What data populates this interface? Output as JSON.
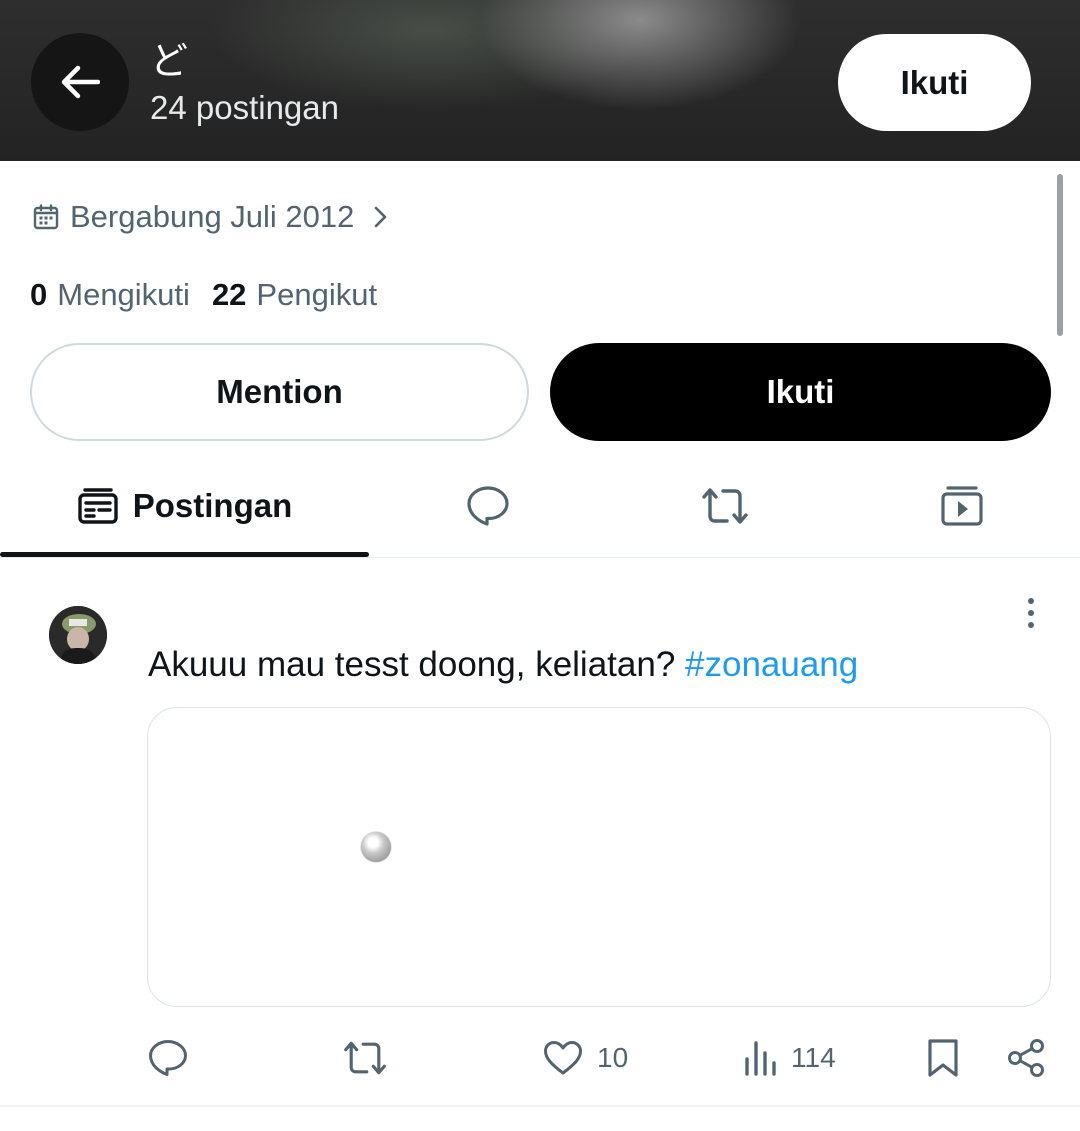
{
  "header": {
    "name": "ど",
    "post_count": "24 postingan",
    "follow_label": "Ikuti"
  },
  "profile": {
    "joined": "Bergabung Juli 2012",
    "following_count": "0",
    "following_label": "Mengikuti",
    "followers_count": "22",
    "followers_label": "Pengikut"
  },
  "actions": {
    "mention_label": "Mention",
    "follow_label": "Ikuti"
  },
  "tabs": {
    "posts_label": "Postingan",
    "icons": [
      "posts-icon",
      "reply-icon",
      "repost-icon",
      "media-icon"
    ]
  },
  "post": {
    "text": "Akuuu mau tesst doong, keliatan? ",
    "hashtag": "#zonauang",
    "likes": "10",
    "views": "114",
    "link_color": "#1d9bf0"
  },
  "colors": {
    "primary_text": "#0f1419",
    "secondary_text": "#536471",
    "follow_bg": "#000000"
  }
}
